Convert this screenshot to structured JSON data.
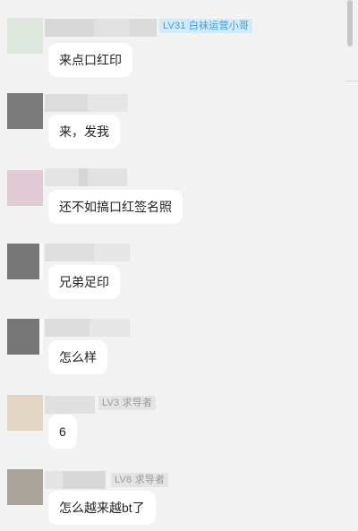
{
  "messages": [
    {
      "badge": "LV31 白袜运营小哥",
      "badge_style": "blue",
      "text": "来点口红印",
      "avatar_color": "#dfe8de"
    },
    {
      "badge": "",
      "badge_style": "",
      "text": "来，发我",
      "avatar_color": "#7a7a7a"
    },
    {
      "badge": "",
      "badge_style": "",
      "text": "还不如搞口红签名照",
      "avatar_color": "#e2cbd5"
    },
    {
      "badge": "",
      "badge_style": "",
      "text": "兄弟足印",
      "avatar_color": "#777777"
    },
    {
      "badge": "",
      "badge_style": "",
      "text": "怎么样",
      "avatar_color": "#777777"
    },
    {
      "badge": "LV3 求导者",
      "badge_style": "grey",
      "text": "6",
      "avatar_color": "#e3d6c5"
    },
    {
      "badge": "LV8 求导者",
      "badge_style": "grey",
      "text": "怎么越来越bt了",
      "avatar_color": "#aaa39c"
    }
  ]
}
